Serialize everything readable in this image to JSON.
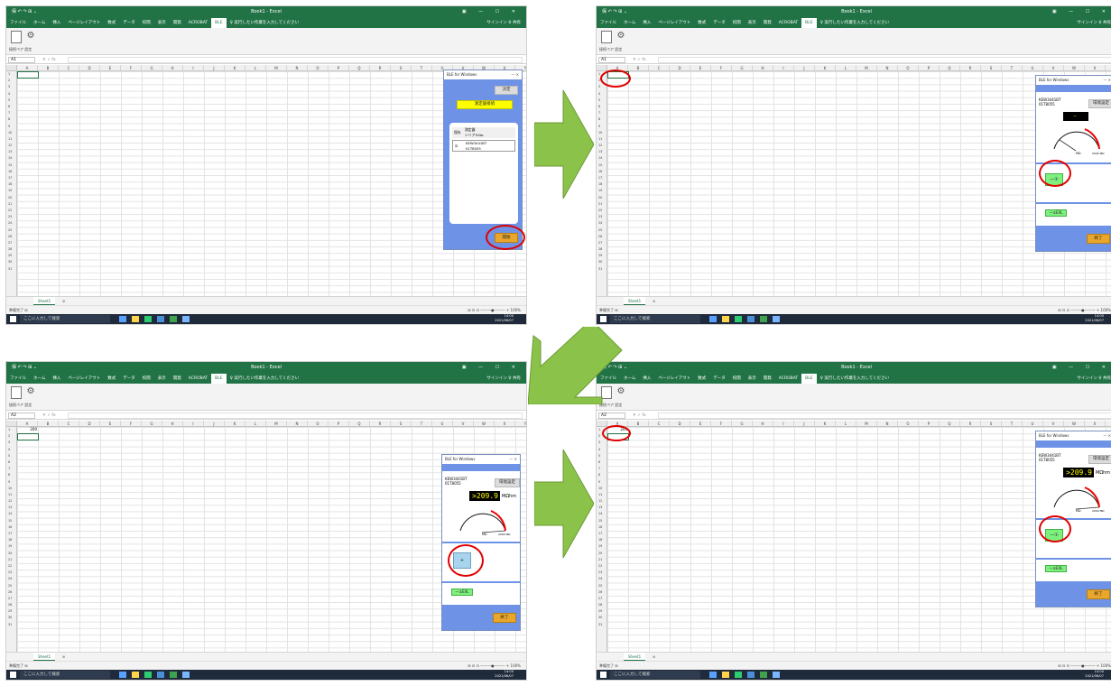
{
  "excel": {
    "title": "Book1 - Excel",
    "qat": "保 ↶ ↷ ⊞ ⌄",
    "window_controls": "▣ — ☐ ✕",
    "tabs": [
      "ファイル",
      "ホーム",
      "挿入",
      "ページレイアウト",
      "数式",
      "データ",
      "校閲",
      "表示",
      "開発",
      "ACROBAT"
    ],
    "active_tab": "BLE",
    "tell_me": "♀ 実行したい作業を入力してください",
    "user": "サインイン  ♀ 共有",
    "ribbon_group_label": "接続ペア  設定",
    "name_box": "A1",
    "name_box_after": "A2",
    "fx": "✕  ✓  fx",
    "columns": [
      "A",
      "B",
      "C",
      "D",
      "E",
      "F",
      "G",
      "H",
      "I",
      "J",
      "K",
      "L",
      "M",
      "N",
      "O",
      "P",
      "Q",
      "R",
      "S",
      "T",
      "U",
      "V",
      "W",
      "X",
      "Y",
      "Z"
    ],
    "rows": [
      "1",
      "2",
      "3",
      "4",
      "5",
      "6",
      "7",
      "8",
      "9",
      "10",
      "11",
      "12",
      "13",
      "14",
      "15",
      "16",
      "17",
      "18",
      "19",
      "20",
      "21",
      "22",
      "23",
      "24",
      "25",
      "26",
      "27",
      "28",
      "29",
      "30",
      "31"
    ],
    "cell_value": "200",
    "sheet_tab": "Sheet1",
    "add_sheet": "⊕",
    "status": "準備完了  ⊞",
    "zoom": "⊞  ⊟  ⊡  ———●——— + 100%",
    "search_placeholder": "ここに入力して検索",
    "clock_time": "14:00",
    "clock_date": "2021/06/07"
  },
  "panel": {
    "title": "BLE for Windows",
    "close": "— ✕",
    "decide_button": "決定",
    "measure_list_button": "測定器接続",
    "list_header_model": "測定器",
    "list_header_serial": "シリアルNo.",
    "list_header_col1": "保存",
    "row_model": "KEW3441BT",
    "row_serial": "01T8055",
    "row_check": "☑",
    "start_button": "開始",
    "device_model": "KEW3441BT",
    "device_serial": "01T8055",
    "env_button": "環境設定",
    "readout_idle": "—",
    "readout_value": ">209.9",
    "readout_unit": "MΩhm",
    "gauge_label_mohm": "MΩ",
    "gauge_label_max": "2000 MΩ",
    "measure_button_idle": "—①",
    "measure_button_active": "+",
    "save_button": "—①EXL",
    "exit_button": "終了"
  },
  "colors": {
    "excel_green": "#217346",
    "panel_blue": "#6d92e6",
    "arrow_green": "#8bc34a",
    "highlight_red": "#e00000"
  }
}
